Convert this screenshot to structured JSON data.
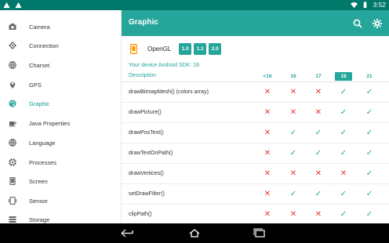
{
  "status": {
    "time": "3:52"
  },
  "appbar": {
    "title": "Graphic"
  },
  "sidebar": {
    "items": [
      {
        "label": "Camera",
        "icon": "camera-icon"
      },
      {
        "label": "Connection",
        "icon": "connection-icon"
      },
      {
        "label": "Charset",
        "icon": "globe-icon"
      },
      {
        "label": "GPS",
        "icon": "location-icon"
      },
      {
        "label": "Graphic",
        "icon": "palette-icon",
        "active": true
      },
      {
        "label": "Java Properties",
        "icon": "coffee-icon"
      },
      {
        "label": "Language",
        "icon": "globe-icon"
      },
      {
        "label": "Processes",
        "icon": "chip-icon"
      },
      {
        "label": "Screen",
        "icon": "screen-icon"
      },
      {
        "label": "Sensor",
        "icon": "sensor-icon"
      },
      {
        "label": "Storage",
        "icon": "storage-icon"
      }
    ]
  },
  "opengl": {
    "label": "OpenGL",
    "versions": [
      "1.0",
      "1.1",
      "2.0"
    ]
  },
  "sdk_line": "Your device Android SDK: 18",
  "table": {
    "description_header": "Description",
    "columns": [
      "<16",
      "16",
      "17",
      "18",
      "21"
    ],
    "selected_column": "18",
    "rows": [
      {
        "name": "drawBitmapMesh() (colors array)",
        "support": [
          false,
          false,
          false,
          true,
          true
        ]
      },
      {
        "name": "drawPicture()",
        "support": [
          false,
          false,
          false,
          true,
          true
        ]
      },
      {
        "name": "drawPosText()",
        "support": [
          false,
          true,
          true,
          true,
          true
        ]
      },
      {
        "name": "drawTextOnPath()",
        "support": [
          false,
          true,
          true,
          true,
          true
        ]
      },
      {
        "name": "drawVertices()",
        "support": [
          false,
          false,
          false,
          false,
          true
        ]
      },
      {
        "name": "setDrawFilter()",
        "support": [
          false,
          true,
          true,
          true,
          true
        ]
      },
      {
        "name": "clipPath()",
        "support": [
          false,
          false,
          false,
          true,
          true
        ]
      }
    ]
  },
  "colors": {
    "primary": "#26a69a",
    "primary_dark": "#00796b",
    "error": "#e53935"
  }
}
